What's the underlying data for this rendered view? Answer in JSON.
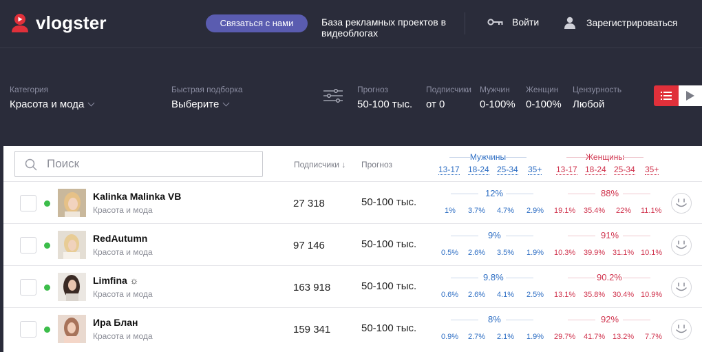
{
  "header": {
    "logo_text": "vlogster",
    "contact_button": "Связаться с нами",
    "tagline": "База рекламных проектов в видеоблогах",
    "login": "Войти",
    "register": "Зарегистрироваться"
  },
  "filters": {
    "category": {
      "label": "Категория",
      "value": "Красота и мода"
    },
    "quick": {
      "label": "Быстрая подборка",
      "value": "Выберите"
    },
    "forecast": {
      "label": "Прогноз",
      "value": "50-100 тыс."
    },
    "subscribers": {
      "label": "Подписчики",
      "value": "от 0"
    },
    "men": {
      "label": "Мужчин",
      "value": "0-100%"
    },
    "women": {
      "label": "Женщин",
      "value": "0-100%"
    },
    "censorship": {
      "label": "Цензурность",
      "value": "Любой"
    }
  },
  "table": {
    "search_placeholder": "Поиск",
    "col_subscribers": "Подписчики ↓",
    "col_forecast": "Прогноз",
    "group_men": "Мужчины",
    "group_women": "Женщины",
    "ages": [
      "13-17",
      "18-24",
      "25-34",
      "35+"
    ],
    "rows": [
      {
        "name": "Kalinka Malinka VB",
        "category": "Красота и мода",
        "subscribers": "27 318",
        "forecast": "50-100 тыс.",
        "men_total": "12%",
        "men": [
          "1%",
          "3.7%",
          "4.7%",
          "2.9%"
        ],
        "women_total": "88%",
        "women": [
          "19.1%",
          "35.4%",
          "22%",
          "11.1%"
        ]
      },
      {
        "name": "RedAutumn",
        "category": "Красота и мода",
        "subscribers": "97 146",
        "forecast": "50-100 тыс.",
        "men_total": "9%",
        "men": [
          "0.5%",
          "2.6%",
          "3.5%",
          "1.9%"
        ],
        "women_total": "91%",
        "women": [
          "10.3%",
          "39.9%",
          "31.1%",
          "10.1%"
        ]
      },
      {
        "name": "Limfina ☼",
        "category": "Красота и мода",
        "subscribers": "163 918",
        "forecast": "50-100 тыс.",
        "men_total": "9.8%",
        "men": [
          "0.6%",
          "2.6%",
          "4.1%",
          "2.5%"
        ],
        "women_total": "90.2%",
        "women": [
          "13.1%",
          "35.8%",
          "30.4%",
          "10.9%"
        ]
      },
      {
        "name": "Ира Блан",
        "category": "Красота и мода",
        "subscribers": "159 341",
        "forecast": "50-100 тыс.",
        "men_total": "8%",
        "men": [
          "0.9%",
          "2.7%",
          "2.1%",
          "1.9%"
        ],
        "women_total": "92%",
        "women": [
          "29.7%",
          "41.7%",
          "13.2%",
          "7.7%"
        ]
      }
    ]
  },
  "colors": {
    "accent_red": "#e0303a",
    "men_blue": "#2f6fc4",
    "women_red": "#d0344e",
    "online_green": "#3cbd4a"
  }
}
